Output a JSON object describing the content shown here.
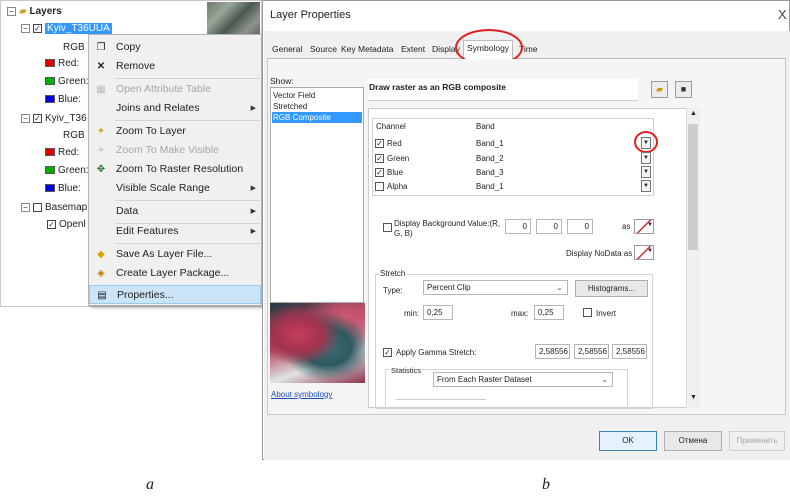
{
  "toc": {
    "root_label": "Layers",
    "layer1_name": "Kyiv_T36UUA",
    "layer1_renderer": "RGB",
    "layer1_red": "Red:",
    "layer1_green": "Green:",
    "layer1_blue": "Blue:",
    "layer2_name": "Kyiv_T36",
    "layer2_renderer": "RGB",
    "layer2_red": "Red:",
    "layer2_green": "Green:",
    "layer2_blue": "Blue:",
    "basemap_name": "Basemap",
    "basemap_sub": "Openl"
  },
  "context_menu": {
    "copy": "Copy",
    "remove": "Remove",
    "open_attribute_table": "Open Attribute Table",
    "joins_relates": "Joins and Relates",
    "zoom_to_layer": "Zoom To Layer",
    "zoom_make_visible": "Zoom To Make Visible",
    "zoom_raster_resolution": "Zoom To Raster Resolution",
    "visible_scale_range": "Visible Scale Range",
    "data": "Data",
    "edit_features": "Edit Features",
    "save_layer_file": "Save As Layer File...",
    "create_layer_package": "Create Layer Package...",
    "properties": "Properties..."
  },
  "dialog": {
    "title": "Layer Properties",
    "close": "X",
    "tabs": [
      "General",
      "Source",
      "Key Metadata",
      "Extent",
      "Display",
      "Symbology",
      "Time"
    ],
    "show_label": "Show:",
    "show_items": [
      "Vector Field",
      "Stretched",
      "RGB Composite"
    ],
    "heading": "Draw raster as an RGB composite",
    "channel_header": "Channel",
    "band_header": "Band",
    "channels": [
      {
        "name": "Red",
        "band": "Band_1",
        "checked": true
      },
      {
        "name": "Green",
        "band": "Band_2",
        "checked": true
      },
      {
        "name": "Blue",
        "band": "Band_3",
        "checked": true
      },
      {
        "name": "Alpha",
        "band": "Band_1",
        "checked": false
      }
    ],
    "display_bg_label": "Display Background Value:(R, G, B)",
    "bg_r": "0",
    "bg_g": "0",
    "bg_b": "0",
    "as_label": "as",
    "display_nodata_label": "Display NoData as",
    "stretch_label": "Stretch",
    "type_label": "Type:",
    "type_value": "Percent Clip",
    "histograms_button": "Histograms...",
    "min_label": "min:",
    "min_value": "0,25",
    "max_label": "max:",
    "max_value": "0,25",
    "invert_label": "Invert",
    "gamma_label": "Apply Gamma Stretch:",
    "gamma_r": "2,58556",
    "gamma_g": "2,58556",
    "gamma_b": "2,58556",
    "statistics_label": "Statistics",
    "statistics_value": "From Each Raster Dataset",
    "about_link": "About symbology",
    "ok": "OK",
    "cancel": "Отмена",
    "apply": "Применить"
  },
  "captions": {
    "a": "a",
    "b": "b"
  }
}
